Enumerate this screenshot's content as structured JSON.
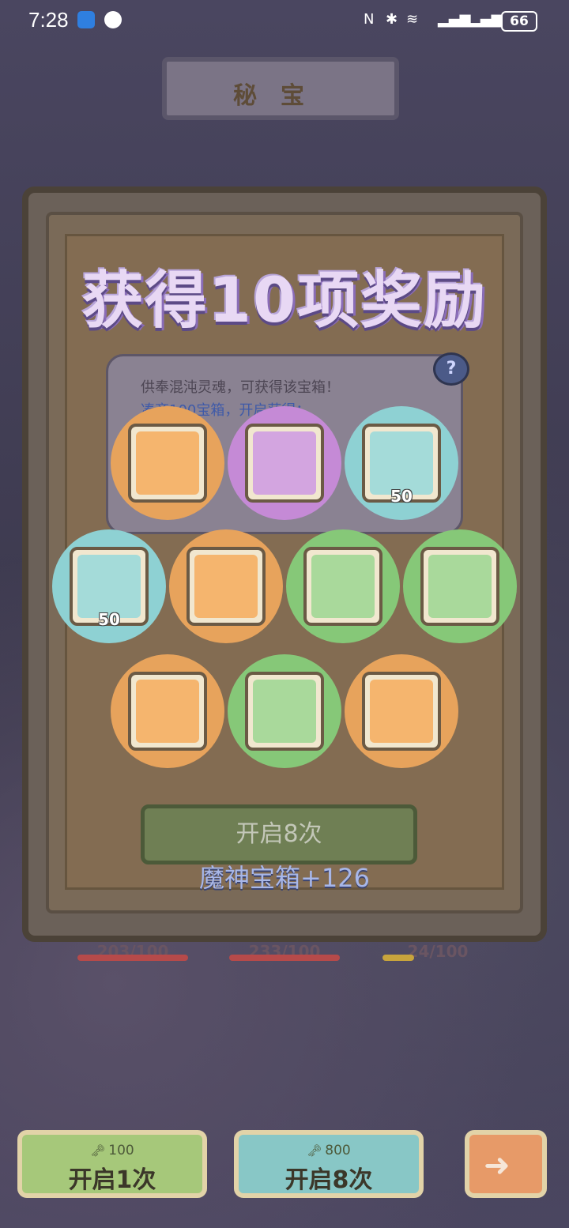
{
  "status": {
    "time": "7:28",
    "battery": "66"
  },
  "header": {
    "title": "秘宝"
  },
  "modal": {
    "title": "获得10项奖励",
    "desc_line1": "供奉混沌灵魂，可获得该宝箱！",
    "desc_line2": "凑齐100宝箱，开启获得：",
    "help": "?"
  },
  "rewards": [
    {
      "name": "ring",
      "rarity": "orange",
      "count": ""
    },
    {
      "name": "amulet",
      "rarity": "purple",
      "count": ""
    },
    {
      "name": "paint-bucket",
      "rarity": "teal",
      "count": "50"
    },
    {
      "name": "paint-bucket",
      "rarity": "teal",
      "count": "50"
    },
    {
      "name": "ring",
      "rarity": "orange",
      "count": ""
    },
    {
      "name": "dark-pearl-pendant",
      "rarity": "green",
      "count": ""
    },
    {
      "name": "white-pearl-pendant",
      "rarity": "green",
      "count": ""
    },
    {
      "name": "armor",
      "rarity": "orange",
      "count": ""
    },
    {
      "name": "dark-pearl-pendant",
      "rarity": "green",
      "count": ""
    },
    {
      "name": "ring",
      "rarity": "orange",
      "count": ""
    }
  ],
  "open_button": "开启8次",
  "bonus": "魔神宝箱+126",
  "progress": [
    {
      "label": "203/100"
    },
    {
      "label": "233/100"
    },
    {
      "label": "24/100"
    }
  ],
  "bottom": {
    "open1": {
      "cost": "100",
      "label": "开启1次"
    },
    "open8": {
      "cost": "800",
      "label": "开启8次"
    }
  },
  "colors": {
    "orange": "#e7a35c",
    "purple": "#c58ad6",
    "teal": "#8ed1d3",
    "green": "#86c878"
  }
}
